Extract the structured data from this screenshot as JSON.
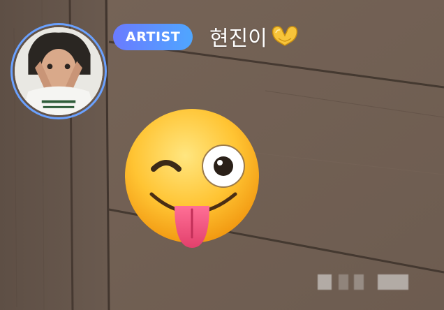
{
  "post": {
    "badge_label": "ARTIST",
    "author_name": "현진이",
    "name_emoji_icon": "heart-hands-icon",
    "content_emoji_icon": "winking-face-with-tongue-icon"
  },
  "avatar": {
    "icon": "profile-photo",
    "ring_color": "#6aa1ff"
  },
  "colors": {
    "badge_gradient_start": "#6a7bff",
    "badge_gradient_end": "#4fa6ff",
    "background": "#6b5a4e",
    "name_text": "#ffffff"
  }
}
